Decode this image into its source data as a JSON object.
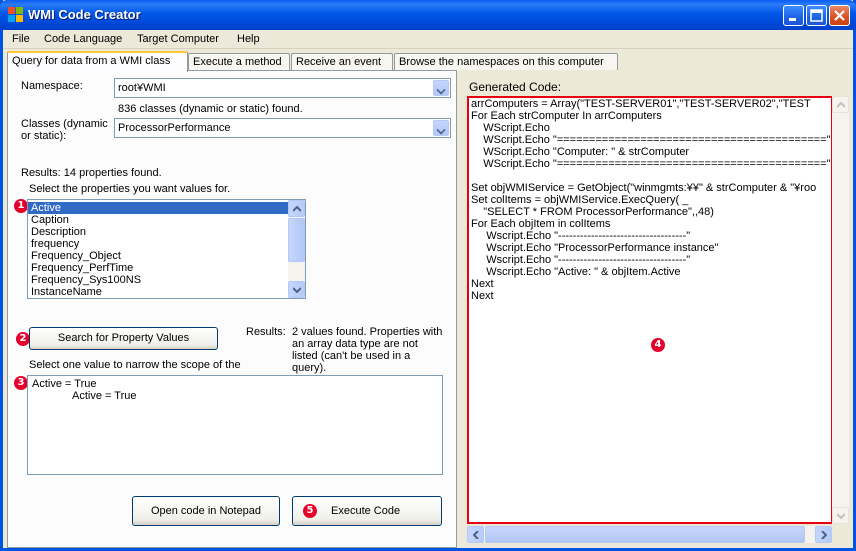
{
  "window": {
    "title": "WMI Code Creator"
  },
  "menu": [
    "File",
    "Code Language",
    "Target Computer",
    "Help"
  ],
  "tabs": [
    "Query for data from a WMI class",
    "Execute a method",
    "Receive an event",
    "Browse the namespaces on this computer"
  ],
  "query": {
    "namespace_label": "Namespace:",
    "namespace_value": "root¥WMI",
    "classes_found": "836 classes (dynamic or static) found.",
    "classes_label_1": "Classes (dynamic",
    "classes_label_2": "or static):",
    "class_value": "ProcessorPerformance",
    "results_label": "Results:  14 properties found.",
    "select_prompt": "Select the properties you want values for.",
    "properties": [
      "Active",
      "Caption",
      "Description",
      "frequency",
      "Frequency_Object",
      "Frequency_PerfTime",
      "Frequency_Sys100NS",
      "InstanceName"
    ],
    "selected_property": "Active",
    "search_button": "Search for Property Values",
    "values_results_label": "Results:",
    "values_results_text_1": "2 values found. Properties with",
    "values_results_text_2": "an array data type are not",
    "values_results_text_3": "listed (can't be used in a",
    "values_results_text_4": "query).",
    "narrow_prompt": "Select one value to narrow the scope of the",
    "values_line_1": "Active = True",
    "values_line_2": "Active = True",
    "open_notepad_button": "Open code in Notepad",
    "execute_button": "Execute Code"
  },
  "generated": {
    "label": "Generated Code:",
    "lines": [
      "arrComputers = Array(\"TEST-SERVER01\",\"TEST-SERVER02\",\"TEST",
      "For Each strComputer In arrComputers",
      "    WScript.Echo",
      "    WScript.Echo \"==========================================\"",
      "    WScript.Echo \"Computer: \" & strComputer",
      "    WScript.Echo \"==========================================\"",
      "",
      "Set objWMIService = GetObject(\"winmgmts:¥¥\" & strComputer & \"¥roo",
      "Set colItems = objWMIService.ExecQuery( _",
      "    \"SELECT * FROM ProcessorPerformance\",,48)",
      "For Each objItem in colItems",
      "     Wscript.Echo \"-----------------------------------\"",
      "     Wscript.Echo \"ProcessorPerformance instance\"",
      "     Wscript.Echo \"-----------------------------------\"",
      "     Wscript.Echo \"Active: \" & objItem.Active",
      "Next",
      "Next"
    ]
  },
  "annotations": [
    "1",
    "2",
    "3",
    "4",
    "5"
  ]
}
